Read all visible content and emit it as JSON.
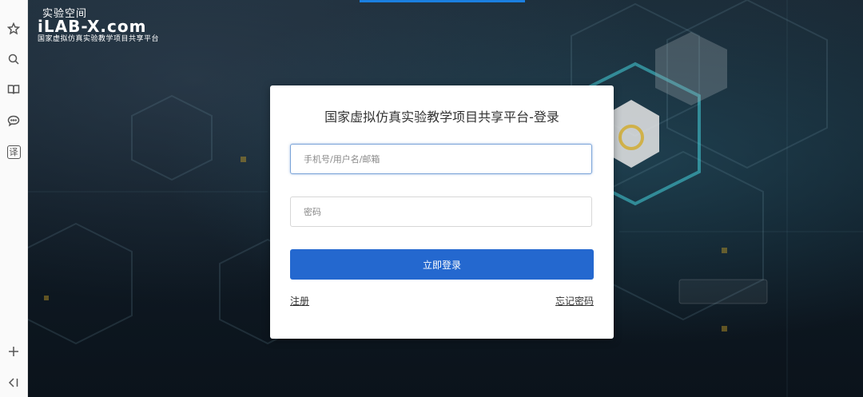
{
  "sidebar": {
    "items": [
      {
        "icon": "star-icon"
      },
      {
        "icon": "search-icon"
      },
      {
        "icon": "book-icon"
      },
      {
        "icon": "chat-icon"
      },
      {
        "icon": "translate-icon",
        "glyph": "译"
      },
      {
        "icon": "plus-icon"
      },
      {
        "icon": "collapse-icon"
      }
    ]
  },
  "logo": {
    "small": "实验空间",
    "big": "LAB-X.com",
    "prefix": "i",
    "sub": "国家虚拟仿真实验教学项目共享平台"
  },
  "login": {
    "title": "国家虚拟仿真实验教学项目共享平台-登录",
    "username_placeholder": "手机号/用户名/邮箱",
    "password_placeholder": "密码",
    "submit_label": "立即登录",
    "register_label": "注册",
    "forgot_label": "忘记密码"
  },
  "colors": {
    "primary": "#2468cf",
    "progress": "#1b7fe0",
    "background": "#0f1a24"
  }
}
